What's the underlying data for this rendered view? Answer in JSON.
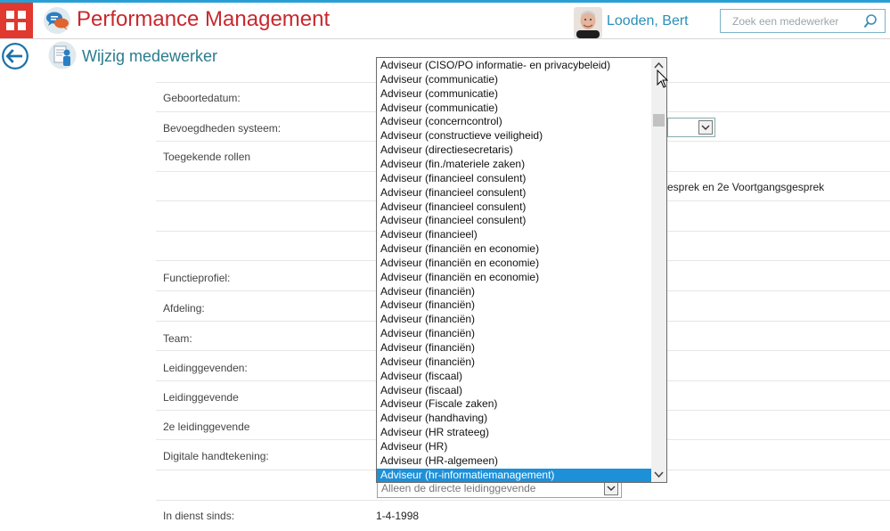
{
  "header": {
    "app_title": "Performance Management",
    "user_name": "Looden, Bert",
    "search_placeholder": "Zoek een medewerker"
  },
  "page": {
    "title": "Wijzig medewerker"
  },
  "form": {
    "labels": {
      "geboortedatum": "Geboortedatum:",
      "bevoegdheden": "Bevoegdheden systeem:",
      "rollen": "Toegekende rollen",
      "functieprofiel": "Functieprofiel:",
      "afdeling": "Afdeling:",
      "team": "Team:",
      "leidinggevenden": "Leidinggevenden:",
      "leidinggevende": "Leidinggevende",
      "tweede_leidinggevende": "2e leidinggevende",
      "handtekening": "Digitale handtekening:",
      "in_dienst": "In dienst sinds:"
    },
    "partial_role_text": "esprek en 2e Voortgangsgesprek",
    "signature_select_value": "Alleen de directe leidinggevende",
    "in_dienst_value": "1-4-1998"
  },
  "dropdown": {
    "options": [
      "Adviseur (CISO/PO informatie- en privacybeleid)",
      "Adviseur (communicatie)",
      "Adviseur (communicatie)",
      "Adviseur (communicatie)",
      "Adviseur (concerncontrol)",
      "Adviseur (constructieve veiligheid)",
      "Adviseur (directiesecretaris)",
      "Adviseur (fin./materiele zaken)",
      "Adviseur (financieel consulent)",
      "Adviseur (financieel consulent)",
      "Adviseur (financieel consulent)",
      "Adviseur (financieel consulent)",
      "Adviseur (financieel)",
      "Adviseur (financiën en economie)",
      "Adviseur (financiën en economie)",
      "Adviseur (financiën en economie)",
      "Adviseur (financiën)",
      "Adviseur (financiën)",
      "Adviseur (financiën)",
      "Adviseur (financiën)",
      "Adviseur (financiën)",
      "Adviseur (financiën)",
      "Adviseur (fiscaal)",
      "Adviseur (fiscaal)",
      "Adviseur (Fiscale zaken)",
      "Adviseur (handhaving)",
      "Adviseur (HR strateeg)",
      "Adviseur (HR)",
      "Adviseur (HR-algemeen)",
      "Adviseur (hr-informatiemanagement)"
    ],
    "selected_index": 29
  },
  "colors": {
    "brand_red": "#c8282e",
    "accent_blue": "#2a9fd6",
    "selection_blue": "#1e90d8"
  },
  "icons": {
    "apps": "apps-grid-icon",
    "logo": "chat-bubbles-logo-icon",
    "search": "search-icon",
    "back": "back-arrow-icon",
    "page": "employee-edit-icon"
  }
}
